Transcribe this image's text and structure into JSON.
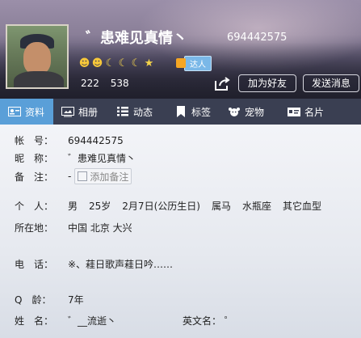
{
  "profile": {
    "nickname_display": "゛患难见真情丶",
    "qq_number": "694442575",
    "level_icons": [
      "sun",
      "sun",
      "moon",
      "moon",
      "moon",
      "star"
    ],
    "badge_label": "达人",
    "count_a": "222",
    "count_b": "538"
  },
  "actions": {
    "add_friend": "加为好友",
    "send_message": "发送消息"
  },
  "tabs": [
    {
      "label": "资料",
      "icon": "id-card-icon"
    },
    {
      "label": "相册",
      "icon": "photo-album-icon"
    },
    {
      "label": "动态",
      "icon": "feed-list-icon"
    },
    {
      "label": "标签",
      "icon": "bookmark-icon"
    },
    {
      "label": "宠物",
      "icon": "pet-icon"
    },
    {
      "label": "名片",
      "icon": "business-card-icon"
    }
  ],
  "info": {
    "account_label": "帐　号：",
    "account_value": "694442575",
    "nick_label": "昵　称：",
    "nick_value": "゛患难见真情丶",
    "note_label": "备　注：",
    "note_dash": "-",
    "note_button": "添加备注",
    "personal_label": "个　人：",
    "gender": "男",
    "age": "25岁",
    "birthday": "2月7日(公历生日)",
    "zodiac": "属马",
    "constellation": "水瓶座",
    "blood": "其它血型",
    "location_label": "所在地：",
    "location_value": "中国 北京 大兴",
    "phone_label": "电　话：",
    "phone_value": "※、蓕日歌声蓕日吟……",
    "qage_label": "Q　龄：",
    "qage_value": "7年",
    "realname_label": "姓　名：",
    "realname_value": "゛__流逝丶",
    "english_label": "英文名：",
    "english_value": "゜"
  }
}
